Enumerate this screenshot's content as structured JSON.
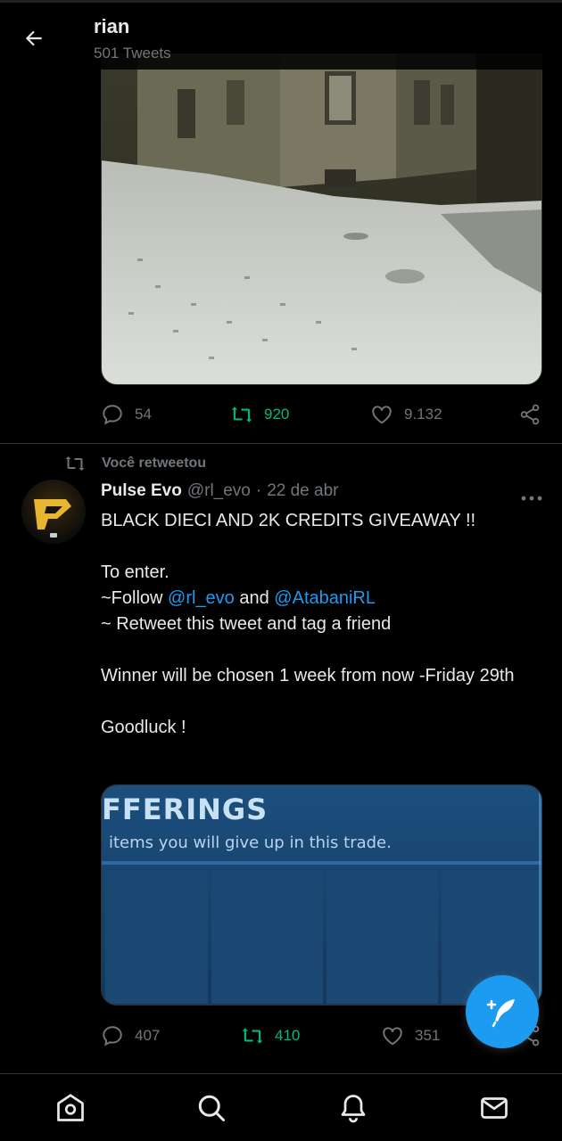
{
  "header": {
    "back_icon": "arrow-left-icon",
    "name": "rian",
    "tweet_count": "501 Tweets"
  },
  "tweet1": {
    "media_description_icon": "photo",
    "reply_count": "54",
    "retweet_count": "920",
    "like_count": "9.132"
  },
  "retweet_context": {
    "label": "Você retweetou"
  },
  "tweet2": {
    "author_name": "Pulse Evo",
    "handle": "@rl_evo",
    "separator": "·",
    "date": "22 de abr",
    "lines": {
      "l1": "BLACK DIECI AND 2K CREDITS GIVEAWAY !!",
      "l2": "To enter.",
      "l3_prefix": "~Follow ",
      "l3_mention1": "@rl_evo",
      "l3_mid": " and ",
      "l3_mention2": "@AtabaniRL",
      "l4": "~ Retweet this tweet and tag a friend",
      "l5": "Winner will be chosen 1 week from now -Friday 29th",
      "l6": "Goodluck !"
    },
    "media": {
      "heading": "FFERINGS",
      "subheading": "items you will give up in this trade."
    },
    "reply_count": "407",
    "retweet_count": "410",
    "like_count": "351"
  },
  "colors": {
    "background": "#000000",
    "accent_blue": "#1d9bf0",
    "retweet_green": "#00ba7c",
    "muted": "#71767b"
  },
  "bottom_nav": [
    "home-icon",
    "search-icon",
    "notifications-icon",
    "messages-icon"
  ]
}
